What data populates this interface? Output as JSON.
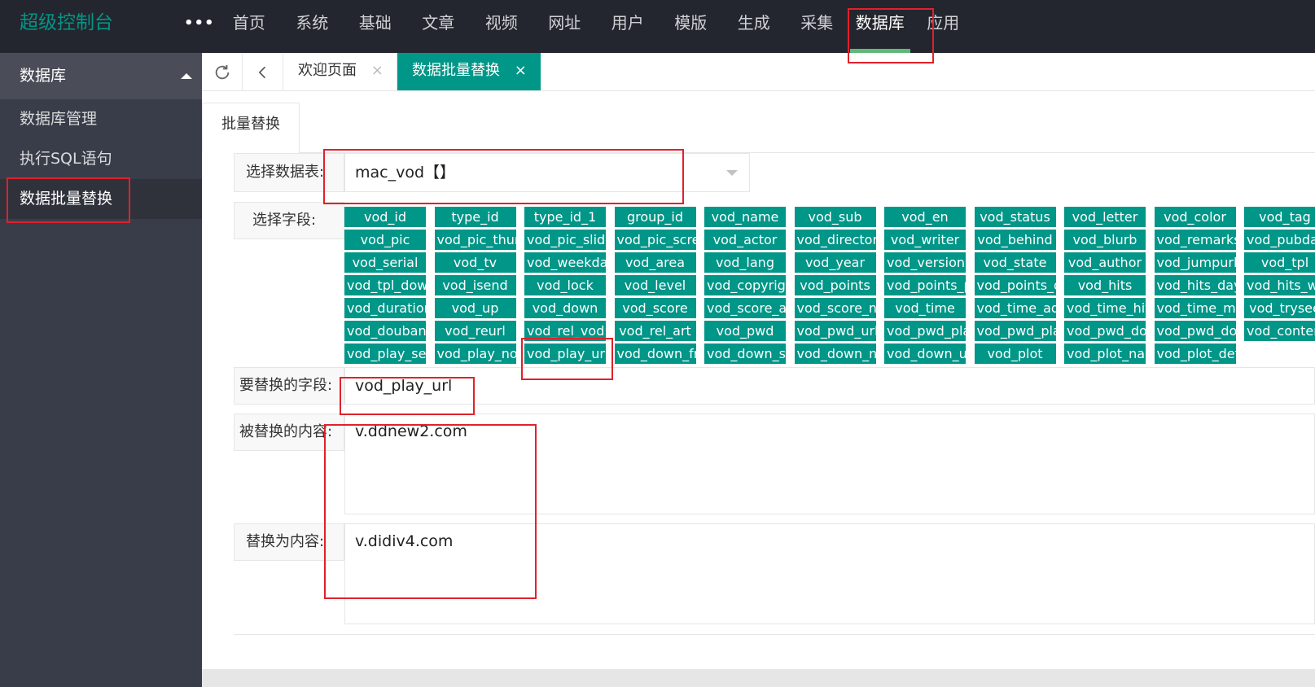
{
  "app": {
    "title": "超级控制台",
    "more": "•••"
  },
  "nav": [
    "首页",
    "系统",
    "基础",
    "文章",
    "视频",
    "网址",
    "用户",
    "模版",
    "生成",
    "采集",
    "数据库",
    "应用"
  ],
  "nav_active": "数据库",
  "sidebar": {
    "header": "数据库",
    "items": [
      {
        "label": "数据库管理"
      },
      {
        "label": "执行SQL语句"
      },
      {
        "label": "数据批量替换"
      }
    ]
  },
  "tabbar": {
    "refresh_icon": "refresh-icon",
    "back_icon": "chevron-left-icon",
    "tabs": [
      {
        "label": "欢迎页面",
        "close": "×"
      },
      {
        "label": "数据批量替换",
        "close": "×"
      }
    ]
  },
  "form": {
    "tab": "批量替换",
    "table_label": "选择数据表:",
    "table_value": "mac_vod【】",
    "fields_label": "选择字段:",
    "replace_field_label": "要替换的字段:",
    "replace_field_value": "vod_play_url",
    "search_label": "被替换的内容:",
    "search_value": "v.ddnew2.com",
    "replace_label": "替换为内容:",
    "replace_value": "v.didiv4.com"
  },
  "fields": [
    [
      "vod_id",
      "type_id",
      "type_id_1",
      "group_id",
      "vod_name",
      "vod_sub",
      "vod_en",
      "vod_status",
      "vod_letter",
      "vod_color",
      "vod_tag"
    ],
    [
      "vod_pic",
      "vod_pic_thumb",
      "vod_pic_slide",
      "vod_pic_screenshot",
      "vod_actor",
      "vod_director",
      "vod_writer",
      "vod_behind",
      "vod_blurb",
      "vod_remarks",
      "vod_pubdate"
    ],
    [
      "vod_serial",
      "vod_tv",
      "vod_weekday",
      "vod_area",
      "vod_lang",
      "vod_year",
      "vod_version",
      "vod_state",
      "vod_author",
      "vod_jumpurl",
      "vod_tpl"
    ],
    [
      "vod_tpl_down",
      "vod_isend",
      "vod_lock",
      "vod_level",
      "vod_copyright",
      "vod_points",
      "vod_points_play",
      "vod_points_down",
      "vod_hits",
      "vod_hits_day",
      "vod_hits_week"
    ],
    [
      "vod_duration",
      "vod_up",
      "vod_down",
      "vod_score",
      "vod_score_all",
      "vod_score_num",
      "vod_time",
      "vod_time_add",
      "vod_time_hits",
      "vod_time_make",
      "vod_trysee"
    ],
    [
      "vod_douban_id",
      "vod_reurl",
      "vod_rel_vod",
      "vod_rel_art",
      "vod_pwd",
      "vod_pwd_url",
      "vod_pwd_play",
      "vod_pwd_play_url",
      "vod_pwd_down",
      "vod_pwd_down_url",
      "vod_content"
    ],
    [
      "vod_play_server",
      "vod_play_note",
      "vod_play_url",
      "vod_down_from",
      "vod_down_server",
      "vod_down_note",
      "vod_down_url",
      "vod_plot",
      "vod_plot_name",
      "vod_plot_detail"
    ]
  ],
  "colors": {
    "accent": "#009688",
    "topbar": "#23262e",
    "sidebar": "#393d49",
    "nav_indicator": "#5fb878",
    "highlight_box": "#e0212b"
  }
}
